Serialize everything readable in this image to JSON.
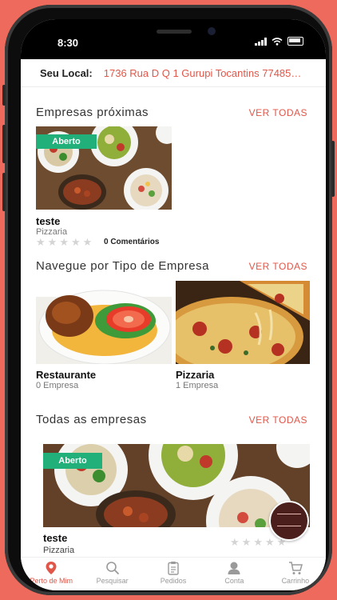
{
  "status": {
    "time": "8:30"
  },
  "location": {
    "label": "Seu Local:",
    "address": "1736 Rua D Q 1 Gurupi Tocantins 77485-0..."
  },
  "nearby": {
    "title": "Empresas próximas",
    "see_all": "VER TODAS",
    "items": [
      {
        "badge": "Aberto",
        "name": "teste",
        "category": "Pizzaria",
        "rating": 0,
        "comments": "0 Comentários"
      }
    ]
  },
  "types": {
    "title": "Navegue por Tipo de Empresa",
    "see_all": "VER TODAS",
    "items": [
      {
        "name": "Restaurante",
        "count": "0 Empresa"
      },
      {
        "name": "Pizzaria",
        "count": "1 Empresa"
      }
    ]
  },
  "all": {
    "title": "Todas as empresas",
    "see_all": "VER TODAS",
    "items": [
      {
        "badge": "Aberto",
        "name": "teste",
        "category": "Pizzaria",
        "rating": 0
      }
    ]
  },
  "nav": {
    "items": [
      {
        "label": "Perto de Mim",
        "icon": "map-pin-icon",
        "active": true
      },
      {
        "label": "Pesquisar",
        "icon": "search-icon",
        "active": false
      },
      {
        "label": "Pedidos",
        "icon": "clipboard-icon",
        "active": false
      },
      {
        "label": "Conta",
        "icon": "user-icon",
        "active": false
      },
      {
        "label": "Carrinho",
        "icon": "cart-icon",
        "active": false
      }
    ]
  },
  "colors": {
    "accent": "#e0574a",
    "open_badge": "#21b07a",
    "background": "#ee6a5c"
  }
}
